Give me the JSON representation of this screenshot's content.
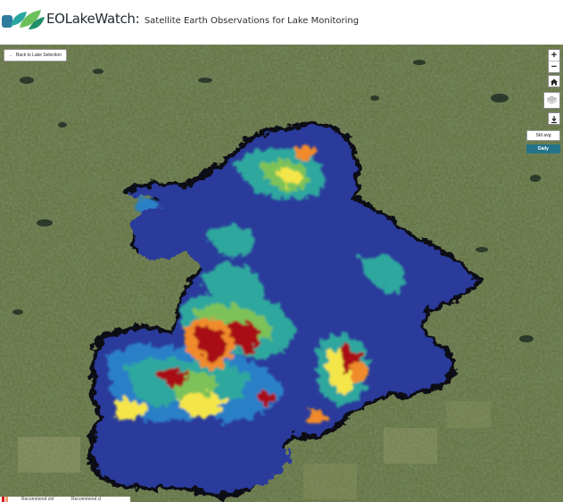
{
  "header": {
    "brand": "EOLakeWatch:",
    "subtitle": "Satellite Earth Observations for Lake Monitoring"
  },
  "map_controls": {
    "back_label": "Back to Lake Selection",
    "zoom_in": "+",
    "zoom_out": "−",
    "date_value": "Std avg",
    "daily_label": "Daily"
  },
  "legend": {
    "items": [
      "Recommend ctrl",
      "Recommend cl"
    ],
    "colors": [
      "#d7191c",
      "#f0a070"
    ]
  },
  "colors": {
    "low": "#2d3fa0",
    "mid_low": "#2a7fc8",
    "mid": "#2ea8a0",
    "mid_high": "#79c257",
    "high": "#f5e84a",
    "very_high": "#f08a2a",
    "extreme": "#a80f12",
    "accent": "#23748a"
  }
}
